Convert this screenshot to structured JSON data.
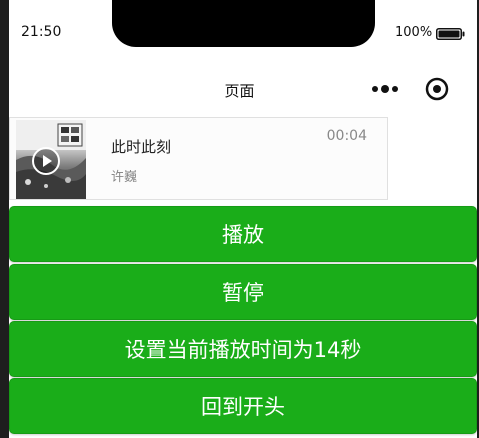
{
  "status_bar": {
    "time": "21:50",
    "battery_percent": "100%",
    "battery_level": 1.0
  },
  "nav": {
    "title": "页面",
    "icons": [
      "more-icon",
      "record-icon"
    ]
  },
  "audio": {
    "name": "此时此刻",
    "author": "许巍",
    "time": "00:04",
    "icons": [
      "play-icon"
    ]
  },
  "buttons": {
    "play_label": "播放",
    "pause_label": "暂停",
    "seek_label": "设置当前播放时间为14秒",
    "restart_label": "回到开头"
  },
  "colors": {
    "primary_button": "#1aad19",
    "button_text": "#ffffff",
    "background": "#ffffff"
  }
}
